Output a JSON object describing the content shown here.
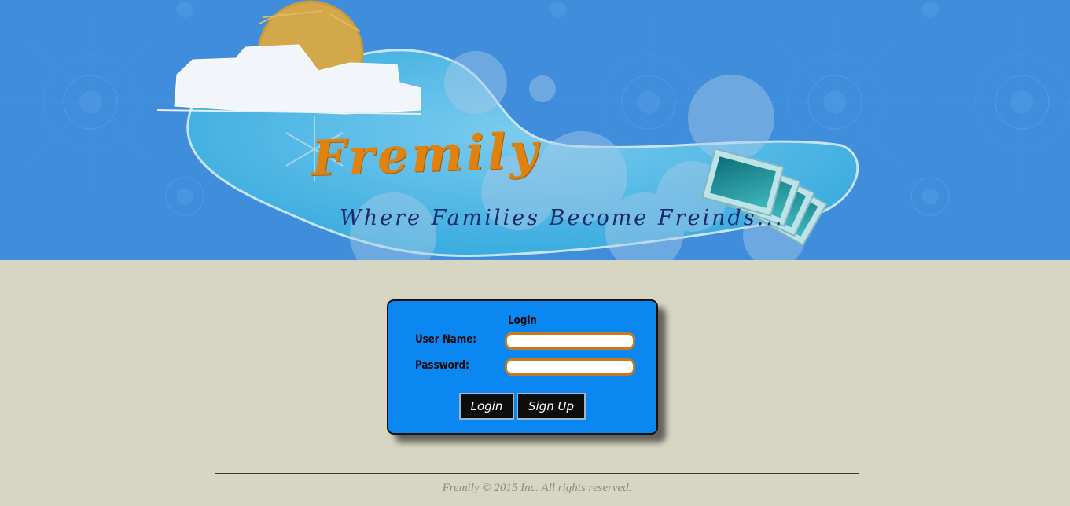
{
  "header": {
    "brand_name": "Fremily",
    "tagline": "Where Families Become Freinds..."
  },
  "login": {
    "title": "Login",
    "username_label": "User Name:",
    "username_value": "",
    "password_label": "Password:",
    "password_value": "",
    "login_button": "Login",
    "signup_button": "Sign Up"
  },
  "footer": {
    "copyright": "Fremily © 2015 Inc. All rights reserved."
  },
  "colors": {
    "banner_bg": "#3f8ddb",
    "page_bg": "#d7d6c2",
    "panel_bg": "#0a87f0",
    "brand": "#e0820f",
    "input_border": "#c97a1c"
  }
}
